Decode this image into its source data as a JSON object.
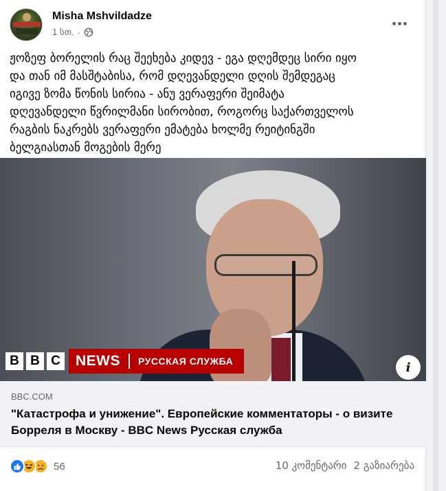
{
  "post": {
    "author": "Misha Mshvildadze",
    "time": "1 სთ.",
    "separator": "·",
    "text": "ჟოზეფ ბორელის რაც შეეხება კიდევ - ეგა დღემდეც სირი იყო\nდა თან იმ მასშტაბისა, რომ დღევანდელი დღის შემდეგაც\nიგივე ზომა წონის სირია - ანუ ვერაფერი შეიმატა\nდღევანდელი წვრილმანი სირობით, როგორც საქართველოს\nრაგბის ნაკრებს ვერაფერი ემატება ხოლმე რეიტინგში\nბელგიასთან მოგების მერე"
  },
  "image_banner": {
    "bbc_letters": [
      "B",
      "B",
      "C"
    ],
    "news_label": "NEWS",
    "service_label": "РУССКАЯ СЛУЖБА"
  },
  "info_icon_glyph": "i",
  "link": {
    "domain": "BBC.COM",
    "title": "\"Катастрофа и унижение\". Европейские комментаторы - о визите Борреля в Москву - BBC News Русская служба"
  },
  "reactions": {
    "types": [
      "like-icon",
      "haha-icon",
      "sad-icon"
    ],
    "count": "56",
    "comments": "10 კომენტარი",
    "shares": "2 გაზიარება"
  },
  "colors": {
    "facebook_blue": "#1877f2",
    "bbc_red": "#b80000",
    "secondary_text": "#65676b"
  }
}
